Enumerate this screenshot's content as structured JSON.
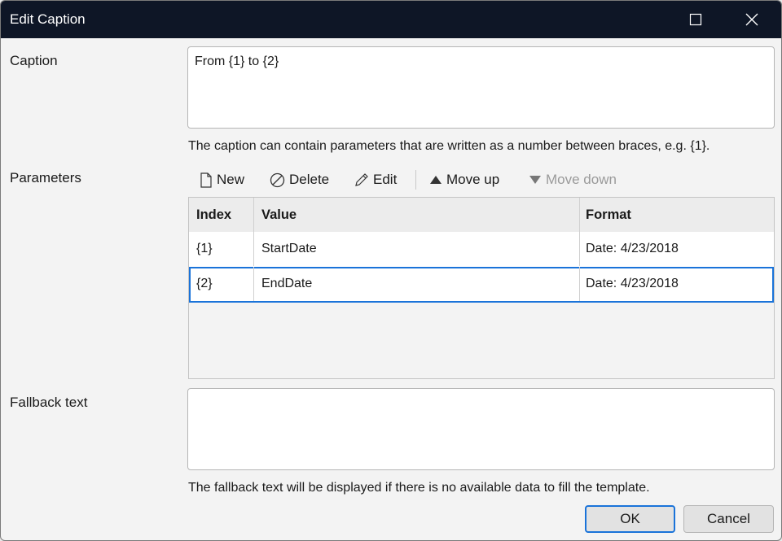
{
  "window": {
    "title": "Edit Caption"
  },
  "caption": {
    "label": "Caption",
    "value": "From {1} to {2}",
    "hint": "The caption can contain parameters that are written as a number between braces, e.g. {1}."
  },
  "parameters": {
    "label": "Parameters",
    "toolbar": {
      "new_label": "New",
      "delete_label": "Delete",
      "edit_label": "Edit",
      "move_up_label": "Move up",
      "move_down_label": "Move down"
    },
    "columns": {
      "index": "Index",
      "value": "Value",
      "format": "Format"
    },
    "rows": [
      {
        "index": "{1}",
        "value": "StartDate",
        "format": "Date: 4/23/2018",
        "selected": false
      },
      {
        "index": "{2}",
        "value": "EndDate",
        "format": "Date: 4/23/2018",
        "selected": true
      }
    ]
  },
  "fallback": {
    "label": "Fallback text",
    "value": "",
    "hint": "The fallback text will be displayed if there is no available data to fill the template."
  },
  "buttons": {
    "ok_label": "OK",
    "cancel_label": "Cancel"
  },
  "colors": {
    "titlebar": "#0e1626",
    "selection": "#1a73d9"
  },
  "icons": [
    "maximize-icon",
    "close-icon",
    "new-document-icon",
    "delete-icon",
    "pencil-icon",
    "triangle-up-icon",
    "triangle-down-icon"
  ]
}
